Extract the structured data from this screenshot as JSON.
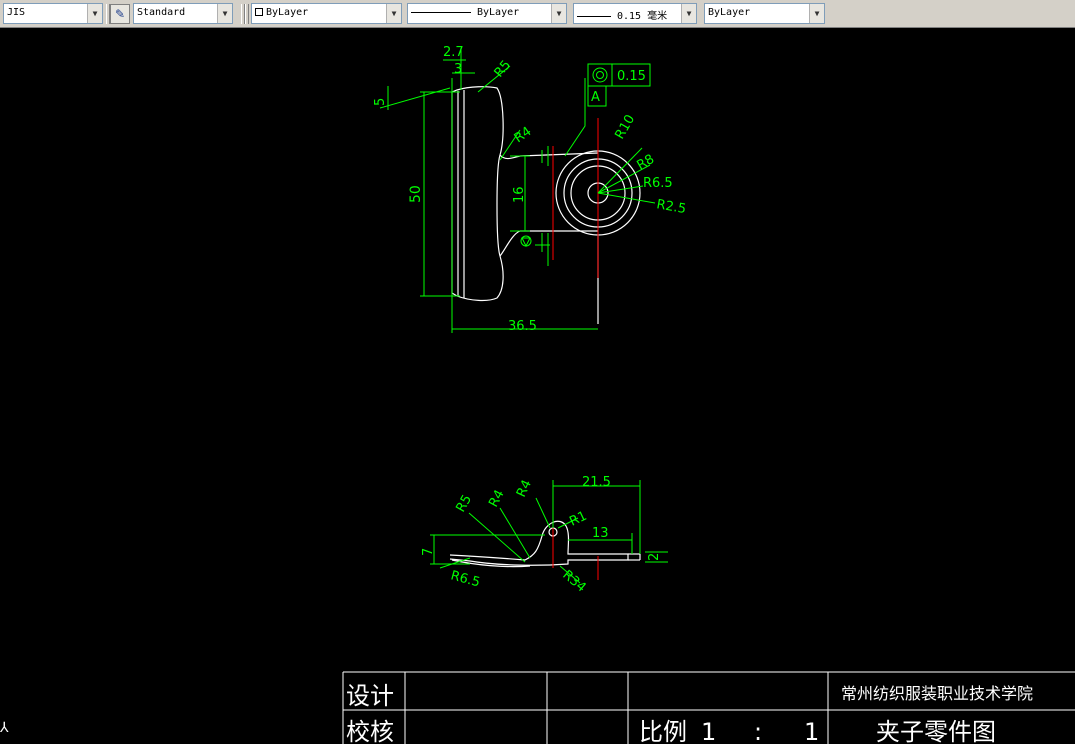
{
  "toolbar": {
    "text_style": "JIS",
    "dim_style": "Standard",
    "layer_color": "ByLayer",
    "linetype": "ByLayer",
    "lineweight": "0.15 毫米",
    "plot_style": "ByLayer"
  },
  "dimensions": {
    "d_2_7": "2.7",
    "d_3": "3",
    "r5_top": "R5",
    "d_5": "5",
    "d_50": "50",
    "r4_top": "R4",
    "d_16": "16",
    "d_36_5": "36.5",
    "r10": "R10",
    "r8": "R8",
    "r6_5": "R6.5",
    "r2_5": "R2.5",
    "tolerance_value": "0.15",
    "datum": "A",
    "d_21_5": "21.5",
    "r4_bottom_a": "R4",
    "r5_bottom": "R5",
    "r4_bottom_b": "R4",
    "r1": "R1",
    "d_13": "13",
    "d_7": "7",
    "r6_5_bottom": "R6.5",
    "r34": "R34",
    "d_2": "2"
  },
  "title_block": {
    "design_label": "设计",
    "review_label": "校核",
    "scale_label": "比例",
    "scale_left": "1",
    "scale_sep": ":",
    "scale_right": "1",
    "school": "常州纺织服装职业技术学院",
    "drawing_title": "夹子零件图"
  },
  "colors": {
    "background": "#000000",
    "outline": "#ffffff",
    "dimension": "#00ff00",
    "centerline": "#ff0000"
  }
}
